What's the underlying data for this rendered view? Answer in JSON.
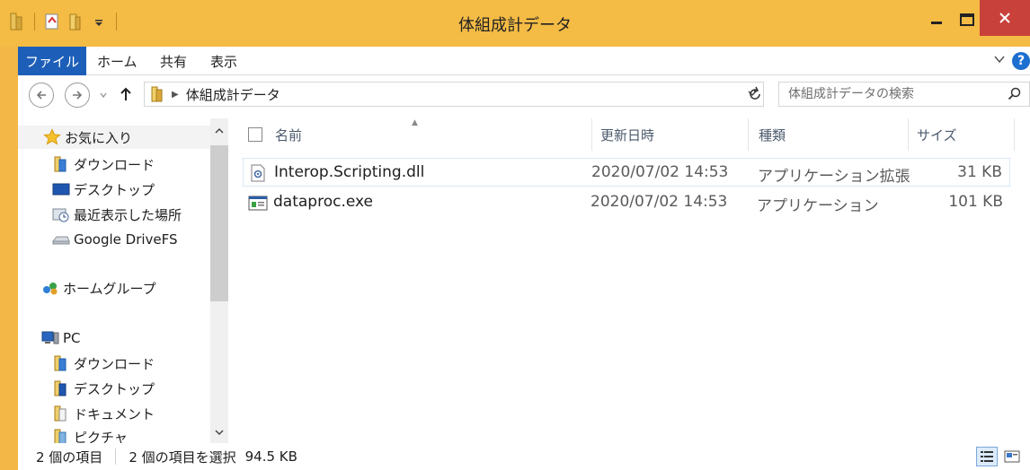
{
  "window": {
    "title": "体組成計データ"
  },
  "ribbon": {
    "tabs": [
      "ファイル",
      "ホーム",
      "共有",
      "表示"
    ]
  },
  "address": {
    "path": "体組成計データ",
    "search_placeholder": "体組成計データの検索"
  },
  "sidebar": {
    "items": [
      {
        "label": "お気に入り",
        "icon": "star-icon"
      },
      {
        "label": "ダウンロード",
        "icon": "download-folder-icon"
      },
      {
        "label": "デスクトップ",
        "icon": "desktop-icon"
      },
      {
        "label": "最近表示した場所",
        "icon": "recent-places-icon"
      },
      {
        "label": "Google DriveFS",
        "icon": "drive-icon"
      },
      {
        "label": "ホームグループ",
        "icon": "homegroup-icon"
      },
      {
        "label": "PC",
        "icon": "pc-icon"
      },
      {
        "label": "ダウンロード",
        "icon": "download-folder-icon"
      },
      {
        "label": "デスクトップ",
        "icon": "desktop-folder-icon"
      },
      {
        "label": "ドキュメント",
        "icon": "documents-folder-icon"
      },
      {
        "label": "ピクチャ",
        "icon": "pictures-folder-icon"
      }
    ]
  },
  "columns": {
    "name": "名前",
    "date": "更新日時",
    "type": "種類",
    "size": "サイズ"
  },
  "files": [
    {
      "name": "Interop.Scripting.dll",
      "date": "2020/07/02 14:53",
      "type": "アプリケーション拡張",
      "size": "31 KB",
      "icon": "dll-file-icon"
    },
    {
      "name": "dataproc.exe",
      "date": "2020/07/02 14:53",
      "type": "アプリケーション",
      "size": "101 KB",
      "icon": "exe-file-icon"
    }
  ],
  "status": {
    "count": "2 個の項目",
    "selected": "2 個の項目を選択",
    "size": "94.5 KB"
  }
}
